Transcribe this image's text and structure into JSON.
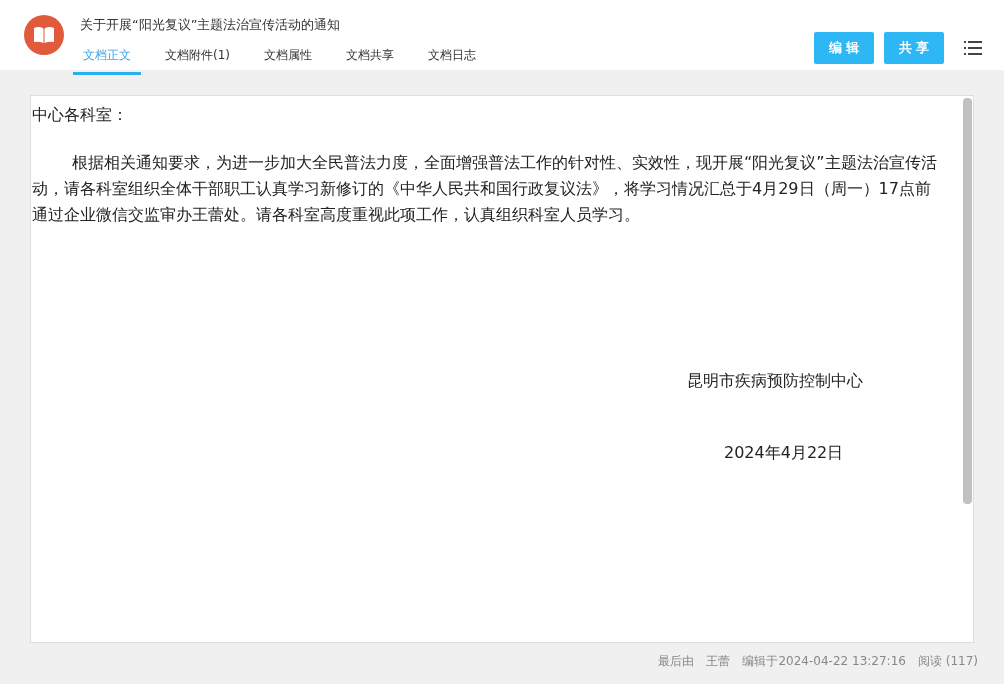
{
  "header": {
    "title": "关于开展“阳光复议”主题法治宣传活动的通知"
  },
  "tabs": [
    {
      "label": "文档正文",
      "selected": true
    },
    {
      "label": "文档附件(1)",
      "selected": false
    },
    {
      "label": "文档属性",
      "selected": false
    },
    {
      "label": "文档共享",
      "selected": false
    },
    {
      "label": "文档日志",
      "selected": false
    }
  ],
  "buttons": [
    {
      "label": "编 辑"
    },
    {
      "label": "共 享"
    }
  ],
  "document": {
    "salutation": "中心各科室：",
    "body": "根据相关通知要求，为进一步加大全民普法力度，全面增强普法工作的针对性、实效性，现开展“阳光复议”主题法治宣传活动，请各科室组织全体干部职工认真学习新修订的《中华人民共和国行政复议法》，将学习情况汇总于4月29日（周一）17点前通过企业微信交监审办王蕾处。请各科室高度重视此项工作，认真组织科室人员学习。",
    "signature": "昆明市疾病预防控制中心",
    "date": "2024年4月22日"
  },
  "footer": {
    "prefix": "最后由",
    "editor": "王蕾",
    "edited": "编辑于2024-04-22 13:27:16",
    "reads": "阅读 (117)"
  }
}
